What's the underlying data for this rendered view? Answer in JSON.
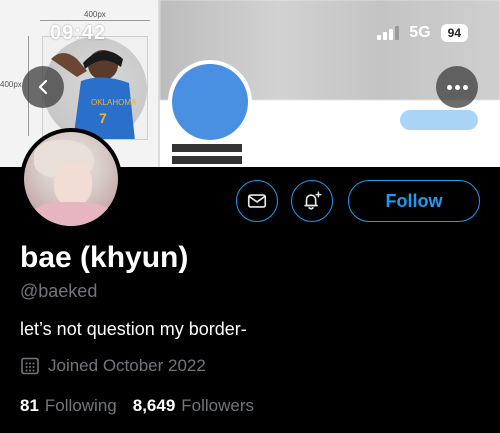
{
  "status_bar": {
    "time": "09:42",
    "network": "5G",
    "battery": "94"
  },
  "banner": {
    "dim_width_label": "400px",
    "dim_height_label": "400px"
  },
  "profile": {
    "display_name": "bae (khyun)",
    "handle": "@baeked",
    "bio": "let’s not question my border-",
    "joined": "Joined October 2022",
    "following_count": "81",
    "following_label": "Following",
    "followers_count": "8,649",
    "followers_label": "Followers"
  },
  "actions": {
    "follow_label": "Follow"
  },
  "icons": {
    "back": "chevron-left-icon",
    "more": "more-horizontal-icon",
    "message": "envelope-icon",
    "notify": "bell-plus-icon",
    "calendar": "calendar-icon"
  },
  "colors": {
    "accent": "#1d9bf0",
    "muted_text": "#71767b",
    "background": "#000000",
    "avatar_placeholder": "#4a90e2"
  }
}
